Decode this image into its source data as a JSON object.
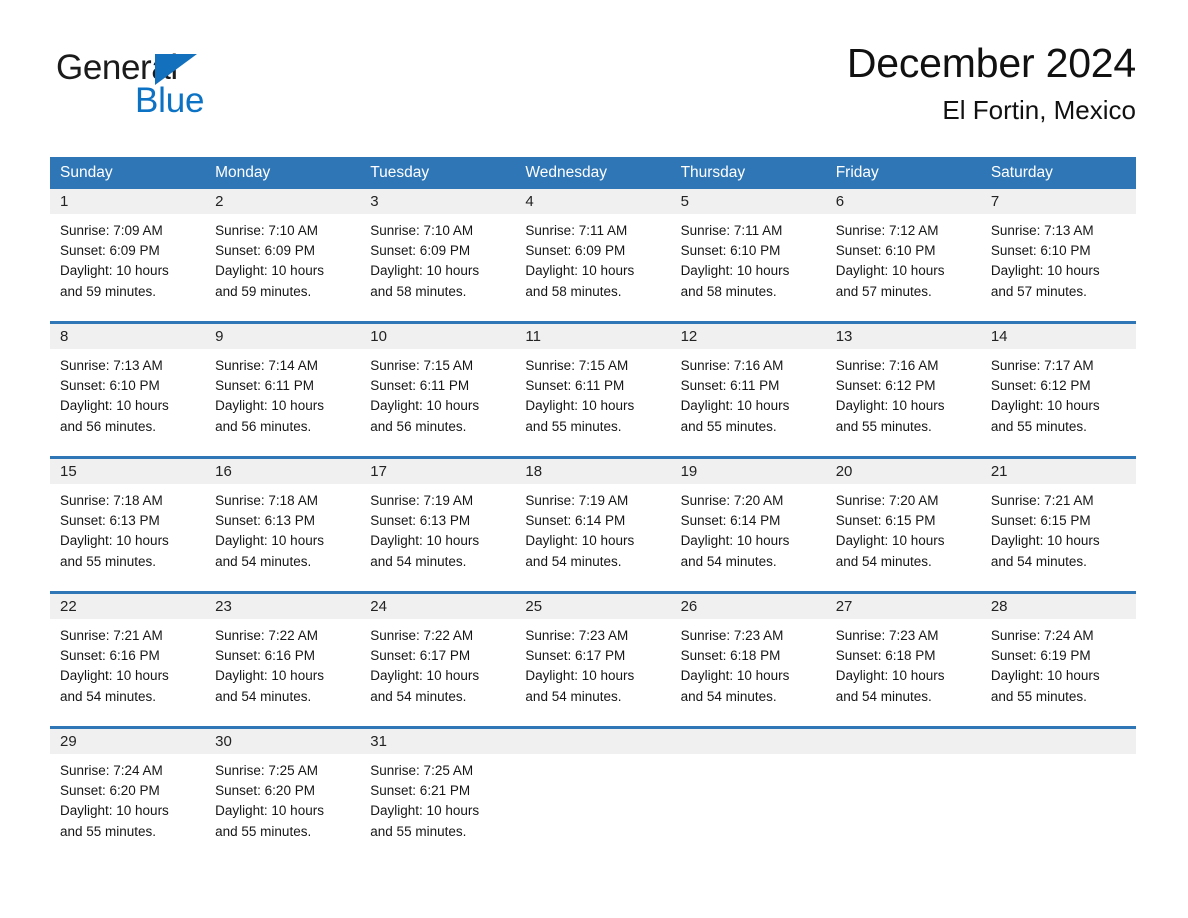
{
  "brand": {
    "name_top": "General",
    "name_bottom": "Blue",
    "accent_color": "#0b72c4",
    "triangle_color": "#1270bd"
  },
  "header": {
    "title": "December 2024",
    "location": "El Fortin, Mexico"
  },
  "theme": {
    "header_blue": "#2f76b7",
    "day_band_gray": "#f0f0f0",
    "text_color": "#161616"
  },
  "calendar": {
    "weekdays": [
      "Sunday",
      "Monday",
      "Tuesday",
      "Wednesday",
      "Thursday",
      "Friday",
      "Saturday"
    ],
    "labels": {
      "sunrise": "Sunrise:",
      "sunset": "Sunset:",
      "daylight": "Daylight:"
    },
    "weeks": [
      [
        {
          "day": "1",
          "sunrise": "Sunrise: 7:09 AM",
          "sunset": "Sunset: 6:09 PM",
          "daylight_line1": "Daylight: 10 hours",
          "daylight_line2": "and 59 minutes."
        },
        {
          "day": "2",
          "sunrise": "Sunrise: 7:10 AM",
          "sunset": "Sunset: 6:09 PM",
          "daylight_line1": "Daylight: 10 hours",
          "daylight_line2": "and 59 minutes."
        },
        {
          "day": "3",
          "sunrise": "Sunrise: 7:10 AM",
          "sunset": "Sunset: 6:09 PM",
          "daylight_line1": "Daylight: 10 hours",
          "daylight_line2": "and 58 minutes."
        },
        {
          "day": "4",
          "sunrise": "Sunrise: 7:11 AM",
          "sunset": "Sunset: 6:09 PM",
          "daylight_line1": "Daylight: 10 hours",
          "daylight_line2": "and 58 minutes."
        },
        {
          "day": "5",
          "sunrise": "Sunrise: 7:11 AM",
          "sunset": "Sunset: 6:10 PM",
          "daylight_line1": "Daylight: 10 hours",
          "daylight_line2": "and 58 minutes."
        },
        {
          "day": "6",
          "sunrise": "Sunrise: 7:12 AM",
          "sunset": "Sunset: 6:10 PM",
          "daylight_line1": "Daylight: 10 hours",
          "daylight_line2": "and 57 minutes."
        },
        {
          "day": "7",
          "sunrise": "Sunrise: 7:13 AM",
          "sunset": "Sunset: 6:10 PM",
          "daylight_line1": "Daylight: 10 hours",
          "daylight_line2": "and 57 minutes."
        }
      ],
      [
        {
          "day": "8",
          "sunrise": "Sunrise: 7:13 AM",
          "sunset": "Sunset: 6:10 PM",
          "daylight_line1": "Daylight: 10 hours",
          "daylight_line2": "and 56 minutes."
        },
        {
          "day": "9",
          "sunrise": "Sunrise: 7:14 AM",
          "sunset": "Sunset: 6:11 PM",
          "daylight_line1": "Daylight: 10 hours",
          "daylight_line2": "and 56 minutes."
        },
        {
          "day": "10",
          "sunrise": "Sunrise: 7:15 AM",
          "sunset": "Sunset: 6:11 PM",
          "daylight_line1": "Daylight: 10 hours",
          "daylight_line2": "and 56 minutes."
        },
        {
          "day": "11",
          "sunrise": "Sunrise: 7:15 AM",
          "sunset": "Sunset: 6:11 PM",
          "daylight_line1": "Daylight: 10 hours",
          "daylight_line2": "and 55 minutes."
        },
        {
          "day": "12",
          "sunrise": "Sunrise: 7:16 AM",
          "sunset": "Sunset: 6:11 PM",
          "daylight_line1": "Daylight: 10 hours",
          "daylight_line2": "and 55 minutes."
        },
        {
          "day": "13",
          "sunrise": "Sunrise: 7:16 AM",
          "sunset": "Sunset: 6:12 PM",
          "daylight_line1": "Daylight: 10 hours",
          "daylight_line2": "and 55 minutes."
        },
        {
          "day": "14",
          "sunrise": "Sunrise: 7:17 AM",
          "sunset": "Sunset: 6:12 PM",
          "daylight_line1": "Daylight: 10 hours",
          "daylight_line2": "and 55 minutes."
        }
      ],
      [
        {
          "day": "15",
          "sunrise": "Sunrise: 7:18 AM",
          "sunset": "Sunset: 6:13 PM",
          "daylight_line1": "Daylight: 10 hours",
          "daylight_line2": "and 55 minutes."
        },
        {
          "day": "16",
          "sunrise": "Sunrise: 7:18 AM",
          "sunset": "Sunset: 6:13 PM",
          "daylight_line1": "Daylight: 10 hours",
          "daylight_line2": "and 54 minutes."
        },
        {
          "day": "17",
          "sunrise": "Sunrise: 7:19 AM",
          "sunset": "Sunset: 6:13 PM",
          "daylight_line1": "Daylight: 10 hours",
          "daylight_line2": "and 54 minutes."
        },
        {
          "day": "18",
          "sunrise": "Sunrise: 7:19 AM",
          "sunset": "Sunset: 6:14 PM",
          "daylight_line1": "Daylight: 10 hours",
          "daylight_line2": "and 54 minutes."
        },
        {
          "day": "19",
          "sunrise": "Sunrise: 7:20 AM",
          "sunset": "Sunset: 6:14 PM",
          "daylight_line1": "Daylight: 10 hours",
          "daylight_line2": "and 54 minutes."
        },
        {
          "day": "20",
          "sunrise": "Sunrise: 7:20 AM",
          "sunset": "Sunset: 6:15 PM",
          "daylight_line1": "Daylight: 10 hours",
          "daylight_line2": "and 54 minutes."
        },
        {
          "day": "21",
          "sunrise": "Sunrise: 7:21 AM",
          "sunset": "Sunset: 6:15 PM",
          "daylight_line1": "Daylight: 10 hours",
          "daylight_line2": "and 54 minutes."
        }
      ],
      [
        {
          "day": "22",
          "sunrise": "Sunrise: 7:21 AM",
          "sunset": "Sunset: 6:16 PM",
          "daylight_line1": "Daylight: 10 hours",
          "daylight_line2": "and 54 minutes."
        },
        {
          "day": "23",
          "sunrise": "Sunrise: 7:22 AM",
          "sunset": "Sunset: 6:16 PM",
          "daylight_line1": "Daylight: 10 hours",
          "daylight_line2": "and 54 minutes."
        },
        {
          "day": "24",
          "sunrise": "Sunrise: 7:22 AM",
          "sunset": "Sunset: 6:17 PM",
          "daylight_line1": "Daylight: 10 hours",
          "daylight_line2": "and 54 minutes."
        },
        {
          "day": "25",
          "sunrise": "Sunrise: 7:23 AM",
          "sunset": "Sunset: 6:17 PM",
          "daylight_line1": "Daylight: 10 hours",
          "daylight_line2": "and 54 minutes."
        },
        {
          "day": "26",
          "sunrise": "Sunrise: 7:23 AM",
          "sunset": "Sunset: 6:18 PM",
          "daylight_line1": "Daylight: 10 hours",
          "daylight_line2": "and 54 minutes."
        },
        {
          "day": "27",
          "sunrise": "Sunrise: 7:23 AM",
          "sunset": "Sunset: 6:18 PM",
          "daylight_line1": "Daylight: 10 hours",
          "daylight_line2": "and 54 minutes."
        },
        {
          "day": "28",
          "sunrise": "Sunrise: 7:24 AM",
          "sunset": "Sunset: 6:19 PM",
          "daylight_line1": "Daylight: 10 hours",
          "daylight_line2": "and 55 minutes."
        }
      ],
      [
        {
          "day": "29",
          "sunrise": "Sunrise: 7:24 AM",
          "sunset": "Sunset: 6:20 PM",
          "daylight_line1": "Daylight: 10 hours",
          "daylight_line2": "and 55 minutes."
        },
        {
          "day": "30",
          "sunrise": "Sunrise: 7:25 AM",
          "sunset": "Sunset: 6:20 PM",
          "daylight_line1": "Daylight: 10 hours",
          "daylight_line2": "and 55 minutes."
        },
        {
          "day": "31",
          "sunrise": "Sunrise: 7:25 AM",
          "sunset": "Sunset: 6:21 PM",
          "daylight_line1": "Daylight: 10 hours",
          "daylight_line2": "and 55 minutes."
        },
        {
          "day": "",
          "sunrise": "",
          "sunset": "",
          "daylight_line1": "",
          "daylight_line2": "",
          "empty": true
        },
        {
          "day": "",
          "sunrise": "",
          "sunset": "",
          "daylight_line1": "",
          "daylight_line2": "",
          "empty": true
        },
        {
          "day": "",
          "sunrise": "",
          "sunset": "",
          "daylight_line1": "",
          "daylight_line2": "",
          "empty": true
        },
        {
          "day": "",
          "sunrise": "",
          "sunset": "",
          "daylight_line1": "",
          "daylight_line2": "",
          "empty": true
        }
      ]
    ]
  }
}
